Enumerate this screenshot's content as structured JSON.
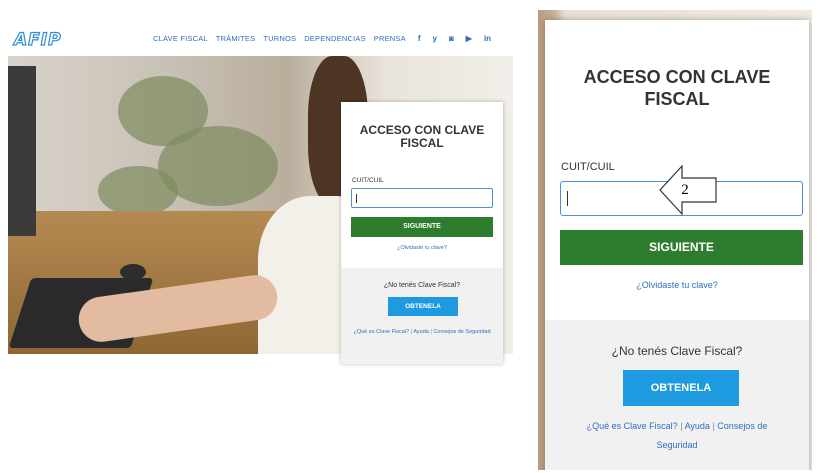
{
  "header": {
    "logo": "AFIP",
    "nav": [
      "CLAVE FISCAL",
      "TRÁMITES",
      "TURNOS",
      "DEPENDENCIAS",
      "PRENSA"
    ],
    "social": [
      "f",
      "y",
      "◙",
      "▶",
      "in"
    ]
  },
  "login": {
    "title_line1": "ACCESO CON CLAVE",
    "title_line2": "FISCAL",
    "field_label": "CUIT/CUIL",
    "field_value": "",
    "next_button": "SIGUIENTE",
    "forgot_link": "¿Olvidaste tu clave?",
    "no_clave_text": "¿No tenés Clave Fiscal?",
    "get_button": "OBTENELA",
    "links": {
      "what_is": "¿Qué es Clave Fiscal?",
      "separator": "|",
      "help": "Ayuda",
      "security_tips": "Consejos de Seguridad"
    }
  },
  "annotation": {
    "arrow_label": "2"
  },
  "colors": {
    "brand_blue": "#2f6fbf",
    "next_green": "#2e7d2e",
    "get_blue": "#1e9be0",
    "input_border": "#4a90d9"
  }
}
